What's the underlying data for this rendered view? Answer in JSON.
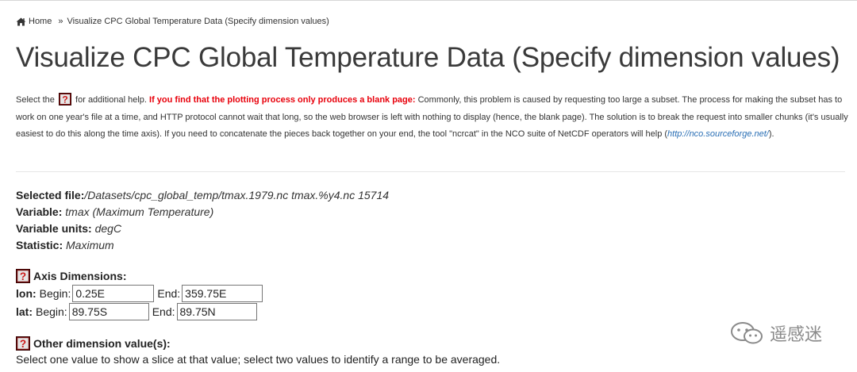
{
  "breadcrumb": {
    "home_label": "Home",
    "separator": "»",
    "current": "Visualize CPC Global Temperature Data (Specify dimension values)"
  },
  "page_title": "Visualize CPC Global Temperature Data (Specify dimension values)",
  "intro": {
    "select_prefix": "Select the",
    "select_suffix": "for additional help.",
    "warning": "If you find that the plotting process only produces a blank page:",
    "body": "Commonly, this problem is caused by requesting too large a subset. The process for making the subset has to work on one year's file at a time, and HTTP protocol cannot wait that long, so the web browser is left with nothing to display (hence, the blank page). The solution is to break the request into smaller chunks (it's usually easiest to do this along the time axis). If you need to concatenate the pieces back together on your end, the tool \"ncrcat\" in the NCO suite of NetCDF operators will help",
    "link_open": "(",
    "link_text": "http://nco.sourceforge.net/",
    "link_close": ")."
  },
  "file_info": {
    "selected_file_label": "Selected file:",
    "selected_file_value": "/Datasets/cpc_global_temp/tmax.1979.nc tmax.%y4.nc 15714",
    "variable_label": "Variable:",
    "variable_value": "tmax (Maximum Temperature)",
    "units_label": "Variable units:",
    "units_value": "degC",
    "statistic_label": "Statistic:",
    "statistic_value": "Maximum"
  },
  "axis": {
    "heading": "Axis Dimensions:",
    "begin_label": "Begin:",
    "end_label": "End:",
    "lon": {
      "name": "lon:",
      "begin": "0.25E",
      "end": "359.75E"
    },
    "lat": {
      "name": "lat:",
      "begin": "89.75S",
      "end": "89.75N"
    }
  },
  "other": {
    "heading": "Other dimension value(s):",
    "text": "Select one value to show a slice at that value; select two values to identify a range to be averaged."
  },
  "watermark": {
    "text": "遥感迷"
  },
  "colors": {
    "warning": "#e8000b",
    "link": "#2a6fb5",
    "help_icon_red": "#cc1a1a"
  }
}
